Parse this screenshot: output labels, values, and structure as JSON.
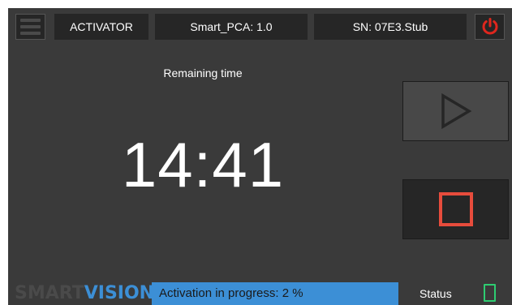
{
  "header": {
    "app_name": "ACTIVATOR",
    "device": "Smart_PCA: 1.0",
    "serial": "SN: 07E3.Stub"
  },
  "icons": {
    "menu": "hamburger-menu-icon",
    "power": "power-icon",
    "play": "play-icon",
    "stop": "stop-icon",
    "status": "device-status-icon"
  },
  "main": {
    "remaining_label": "Remaining time",
    "time": "14:41"
  },
  "footer": {
    "logo_smart": "SMART",
    "logo_vision": "VISION",
    "progress_text": "Activation in progress: 2 %",
    "progress_fraction": 1.0,
    "status_label": "Status"
  },
  "colors": {
    "background": "#3a3a3a",
    "panel": "#262626",
    "accent_blue": "#3c8fd6",
    "power_red": "#e0261d",
    "stop_red": "#e74c3c",
    "status_green": "#2ecc71"
  }
}
